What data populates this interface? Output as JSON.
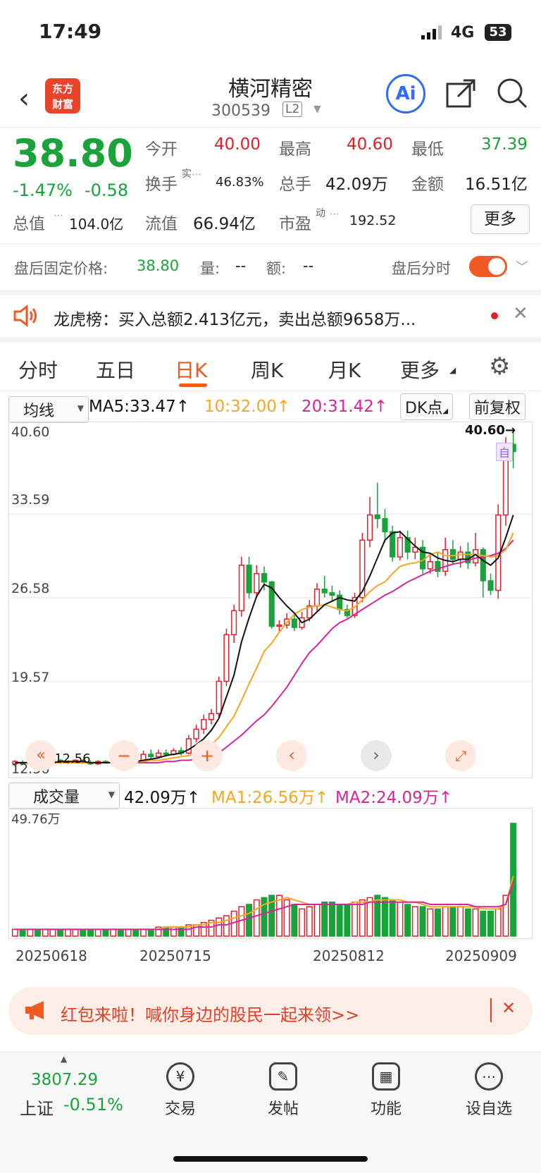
{
  "status": {
    "time": "17:49",
    "network": "4G",
    "battery": "53"
  },
  "header": {
    "title": "横河精密",
    "code": "300539",
    "level": "L2",
    "logo_line1": "东方",
    "logo_line2": "财富",
    "ai_label": "Ai"
  },
  "quote": {
    "price": "38.80",
    "change_pct": "-1.47%",
    "change": "-0.58",
    "open_label": "今开",
    "open": "40.00",
    "high_label": "最高",
    "high": "40.60",
    "low_label": "最低",
    "low": "37.39",
    "turnover_label": "换手",
    "turnover_sup": "实",
    "turnover": "46.83%",
    "volume_label": "总手",
    "volume": "42.09万",
    "amount_label": "金额",
    "amount": "16.51亿",
    "mcap_label": "总值",
    "mcap": "104.0亿",
    "float_label": "流值",
    "float": "66.94亿",
    "pe_label": "市盈",
    "pe_sup": "动",
    "pe": "192.52",
    "more": "更多"
  },
  "afterhours": {
    "label": "盘后固定价格:",
    "price": "38.80",
    "vol_label": "量:",
    "vol": "--",
    "amt_label": "额:",
    "amt": "--",
    "toggle_label": "盘后分时"
  },
  "lhb": {
    "text": "龙虎榜：买入总额2.413亿元，卖出总额9658万..."
  },
  "tabs": [
    "分时",
    "五日",
    "日K",
    "周K",
    "月K",
    "更多"
  ],
  "chart_controls": {
    "ma_select": "均线",
    "ma5": "MA5:33.47",
    "ma10": "10:32.00",
    "ma20": "20:31.42",
    "dk": "DK点",
    "adjust": "前复权"
  },
  "price_axis": [
    "40.60",
    "33.59",
    "26.58",
    "19.57",
    "12.56"
  ],
  "annotations": {
    "max_label": "40.60",
    "min_label": "12.56",
    "self_label": "自"
  },
  "volume_controls": {
    "select": "成交量",
    "vol": "42.09万",
    "ma1": "MA1:26.56万",
    "ma2": "MA2:24.09万",
    "axis_max": "49.76万"
  },
  "dates": [
    "20250618",
    "20250715",
    "20250812",
    "20250909"
  ],
  "banner": {
    "text": "红包来啦！喊你身边的股民一起来领>>"
  },
  "bottom_nav": {
    "index_value": "3807.29",
    "index_name": "上证",
    "index_change": "-0.51%",
    "items": [
      "交易",
      "发帖",
      "功能",
      "设自选"
    ]
  },
  "colors": {
    "up": "#e0202a",
    "down": "#19a33a",
    "ma5": "#111111",
    "ma10": "#f5a623",
    "ma20": "#d6259a",
    "accent": "#f15a24"
  },
  "chart_data": {
    "type": "candlestick",
    "ylim": [
      12.56,
      40.6
    ],
    "dates_shown": [
      "20250618",
      "20250715",
      "20250812",
      "20250909"
    ],
    "candles": [
      [
        12.7,
        12.9,
        12.5,
        13.0
      ],
      [
        12.8,
        12.7,
        12.6,
        13.0
      ],
      [
        12.7,
        12.9,
        12.6,
        13.1
      ],
      [
        12.9,
        12.8,
        12.7,
        13.0
      ],
      [
        12.8,
        12.9,
        12.7,
        13.1
      ],
      [
        12.9,
        13.0,
        12.8,
        13.2
      ],
      [
        13.0,
        12.8,
        12.7,
        13.1
      ],
      [
        12.8,
        12.9,
        12.7,
        13.0
      ],
      [
        12.9,
        13.0,
        12.8,
        13.1
      ],
      [
        13.0,
        12.8,
        12.7,
        13.1
      ],
      [
        12.8,
        12.7,
        12.6,
        13.0
      ],
      [
        12.7,
        12.9,
        12.6,
        13.0
      ],
      [
        12.9,
        12.8,
        12.7,
        13.0
      ],
      [
        12.8,
        12.9,
        12.7,
        13.0
      ],
      [
        12.9,
        12.8,
        12.6,
        13.0
      ],
      [
        12.8,
        13.0,
        12.7,
        13.1
      ],
      [
        13.0,
        12.8,
        12.7,
        13.1
      ],
      [
        12.8,
        13.5,
        12.8,
        13.8
      ],
      [
        13.5,
        13.3,
        13.1,
        13.9
      ],
      [
        13.3,
        13.6,
        13.2,
        13.9
      ],
      [
        13.6,
        13.5,
        13.3,
        13.9
      ],
      [
        13.5,
        13.8,
        13.4,
        14.0
      ],
      [
        13.8,
        13.6,
        13.4,
        14.1
      ],
      [
        13.6,
        14.8,
        13.5,
        15.1
      ],
      [
        14.8,
        15.6,
        14.5,
        16.0
      ],
      [
        15.6,
        16.4,
        15.2,
        16.8
      ],
      [
        16.4,
        16.9,
        16.0,
        17.3
      ],
      [
        16.9,
        19.6,
        16.6,
        20.0
      ],
      [
        19.6,
        23.5,
        19.2,
        24.0
      ],
      [
        23.5,
        25.5,
        22.8,
        26.0
      ],
      [
        25.5,
        29.3,
        25.0,
        30.0
      ],
      [
        29.3,
        27.0,
        26.5,
        30.0
      ],
      [
        27.0,
        28.6,
        26.6,
        29.3
      ],
      [
        28.6,
        27.9,
        27.2,
        29.2
      ],
      [
        27.9,
        24.2,
        24.0,
        28.0
      ],
      [
        24.2,
        24.3,
        23.8,
        24.7
      ],
      [
        24.3,
        24.8,
        24.0,
        25.3
      ],
      [
        24.8,
        24.1,
        23.8,
        25.2
      ],
      [
        24.1,
        24.9,
        23.9,
        25.4
      ],
      [
        24.9,
        25.9,
        24.6,
        26.4
      ],
      [
        25.9,
        27.3,
        25.5,
        27.8
      ],
      [
        27.3,
        27.0,
        26.6,
        28.4
      ],
      [
        27.0,
        26.8,
        26.2,
        27.6
      ],
      [
        26.8,
        25.6,
        25.2,
        27.2
      ],
      [
        25.6,
        25.1,
        24.9,
        26.0
      ],
      [
        25.1,
        26.6,
        24.9,
        27.0
      ],
      [
        26.6,
        31.4,
        26.2,
        32.0
      ],
      [
        31.4,
        33.5,
        30.8,
        35.0
      ],
      [
        33.5,
        33.2,
        32.4,
        36.2
      ],
      [
        33.2,
        32.1,
        31.2,
        34.0
      ],
      [
        32.1,
        30.0,
        29.6,
        32.6
      ],
      [
        30.0,
        31.6,
        29.7,
        32.2
      ],
      [
        31.6,
        30.4,
        29.8,
        32.2
      ],
      [
        30.4,
        30.8,
        29.8,
        31.6
      ],
      [
        30.8,
        29.0,
        28.6,
        31.4
      ],
      [
        29.0,
        29.6,
        28.6,
        30.2
      ],
      [
        29.6,
        28.8,
        28.3,
        30.4
      ],
      [
        28.8,
        30.6,
        28.4,
        31.6
      ],
      [
        30.6,
        29.8,
        29.3,
        31.4
      ],
      [
        29.8,
        30.4,
        29.1,
        30.9
      ],
      [
        30.4,
        29.5,
        29.0,
        31.2
      ],
      [
        29.5,
        30.6,
        29.2,
        32.0
      ],
      [
        30.6,
        28.0,
        26.6,
        30.8
      ],
      [
        28.0,
        27.2,
        26.8,
        28.6
      ],
      [
        27.2,
        33.5,
        26.5,
        34.4
      ],
      [
        33.5,
        39.4,
        32.6,
        40.0
      ],
      [
        39.4,
        38.8,
        37.4,
        40.6
      ]
    ],
    "ma5": [
      12.8,
      12.8,
      12.8,
      12.8,
      12.8,
      12.8,
      12.9,
      12.9,
      12.9,
      12.9,
      12.8,
      12.8,
      12.8,
      12.8,
      12.8,
      12.9,
      12.9,
      13.0,
      13.1,
      13.2,
      13.4,
      13.5,
      13.6,
      13.9,
      14.3,
      14.8,
      15.5,
      16.5,
      18.3,
      20.1,
      22.9,
      24.9,
      26.7,
      27.7,
      27.4,
      26.6,
      25.9,
      25.3,
      24.5,
      24.8,
      25.4,
      26.0,
      26.3,
      26.6,
      26.4,
      26.3,
      27.1,
      28.4,
      29.9,
      31.4,
      32.0,
      32.1,
      31.5,
      30.9,
      30.4,
      30.3,
      29.9,
      29.7,
      29.6,
      29.8,
      29.8,
      30.2,
      29.7,
      29.3,
      29.9,
      31.6,
      33.5
    ],
    "ma10": [
      12.8,
      12.8,
      12.8,
      12.8,
      12.8,
      12.8,
      12.8,
      12.8,
      12.8,
      12.8,
      12.8,
      12.8,
      12.8,
      12.8,
      12.8,
      12.9,
      12.9,
      12.9,
      13.0,
      13.0,
      13.1,
      13.2,
      13.3,
      13.4,
      13.6,
      13.9,
      14.3,
      14.9,
      15.8,
      16.7,
      18.0,
      19.4,
      20.7,
      22.1,
      22.8,
      23.7,
      24.5,
      25.2,
      25.6,
      25.8,
      25.9,
      26.0,
      25.8,
      25.6,
      25.5,
      25.8,
      26.4,
      27.1,
      27.6,
      27.9,
      28.6,
      29.2,
      29.4,
      29.5,
      29.7,
      30.2,
      30.4,
      30.1,
      30.1,
      30.2,
      30.2,
      30.2,
      30.1,
      30.0,
      30.1,
      30.6,
      32.0
    ],
    "ma20": [
      12.8,
      12.8,
      12.8,
      12.8,
      12.8,
      12.8,
      12.8,
      12.8,
      12.8,
      12.8,
      12.8,
      12.8,
      12.8,
      12.8,
      12.8,
      12.8,
      12.8,
      12.8,
      12.8,
      12.8,
      12.9,
      12.9,
      13.0,
      13.0,
      13.1,
      13.2,
      13.4,
      13.6,
      14.1,
      14.6,
      15.1,
      15.7,
      16.3,
      16.8,
      17.5,
      18.3,
      19.1,
      20.1,
      21.1,
      22.0,
      22.6,
      23.3,
      24.0,
      24.5,
      24.8,
      25.2,
      25.6,
      26.0,
      26.4,
      26.8,
      27.1,
      27.5,
      27.9,
      28.2,
      28.5,
      28.8,
      29.0,
      29.2,
      29.4,
      29.5,
      29.7,
      29.9,
      30.0,
      30.1,
      30.3,
      30.7,
      31.4
    ],
    "volume": [
      3,
      3,
      3,
      3,
      3,
      3,
      3,
      3,
      3,
      3,
      3,
      3,
      3,
      3,
      3,
      3,
      3,
      3,
      3,
      4,
      4,
      4,
      4,
      5,
      5,
      6,
      7,
      8,
      9,
      11,
      13,
      14,
      16,
      17,
      18,
      18,
      16,
      14,
      12,
      13,
      14,
      15,
      15,
      14,
      14,
      15,
      16,
      17,
      18,
      17,
      16,
      15,
      14,
      13,
      13,
      12,
      12,
      13,
      13,
      13,
      12,
      12,
      11,
      11,
      12,
      18,
      49.76
    ],
    "vol_ma1": [
      3,
      3,
      3,
      3,
      3,
      3,
      3,
      3,
      3,
      3,
      3,
      3,
      3,
      3,
      3,
      3,
      3,
      3,
      3,
      3,
      4,
      4,
      4,
      4,
      5,
      5,
      6,
      6,
      7,
      8,
      9,
      10,
      12,
      14,
      15,
      16,
      17,
      16,
      15,
      14,
      14,
      14,
      14,
      14,
      14,
      15,
      15,
      15,
      16,
      16,
      16,
      16,
      15,
      15,
      14,
      13,
      13,
      13,
      13,
      13,
      13,
      13,
      12,
      12,
      12,
      14,
      26.56
    ],
    "vol_ma2": [
      3,
      3,
      3,
      3,
      3,
      3,
      3,
      3,
      3,
      3,
      3,
      3,
      3,
      3,
      3,
      3,
      3,
      3,
      3,
      3,
      3,
      3,
      3,
      3,
      4,
      4,
      4,
      5,
      5,
      6,
      7,
      8,
      9,
      10,
      11,
      12,
      13,
      14,
      14,
      14,
      14,
      14,
      14,
      14,
      14,
      14,
      14,
      15,
      15,
      15,
      15,
      15,
      15,
      15,
      15,
      14,
      14,
      14,
      14,
      14,
      14,
      13,
      13,
      13,
      13,
      14,
      24.09
    ]
  }
}
